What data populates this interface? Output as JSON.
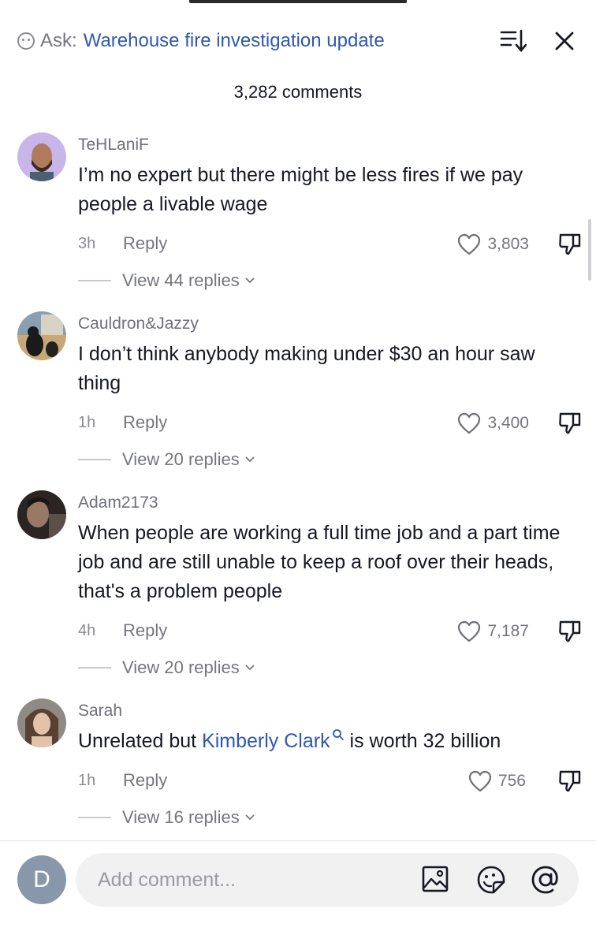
{
  "header": {
    "ask_prefix": "Ask:",
    "ask_query": "Warehouse fire investigation update",
    "icons": {
      "ask": "ask-bubble-icon",
      "sort": "sort-icon",
      "close": "close-icon"
    }
  },
  "comment_count": "3,282 comments",
  "comments": [
    {
      "username": "TeHLaniF",
      "text": "I’m no expert but there might be less fires if we pay people a livable wage",
      "time": "3h",
      "reply_label": "Reply",
      "likes": "3,803",
      "view_replies": "View 44 replies"
    },
    {
      "username": "Cauldron&Jazzy",
      "text": "I don’t think anybody making under $30 an hour saw thing",
      "time": "1h",
      "reply_label": "Reply",
      "likes": "3,400",
      "view_replies": "View 20 replies"
    },
    {
      "username": "Adam2173",
      "text": "When people are working a full time job and a part time job and are still unable to keep a roof over their heads, that's a problem people",
      "time": "4h",
      "reply_label": "Reply",
      "likes": "7,187",
      "view_replies": "View 20 replies"
    },
    {
      "username": "Sarah",
      "text_before": "Unrelated but ",
      "mention": "Kimberly Clark",
      "text_after": " is worth 32 billion",
      "time": "1h",
      "reply_label": "Reply",
      "likes": "756",
      "view_replies": "View 16 replies"
    }
  ],
  "composer": {
    "user_initial": "D",
    "placeholder": "Add comment...",
    "icons": [
      "image-icon",
      "emoji-icon",
      "mention-icon"
    ]
  },
  "colors": {
    "link": "#2f58b0",
    "muted": "#75767d",
    "text": "#161823"
  }
}
